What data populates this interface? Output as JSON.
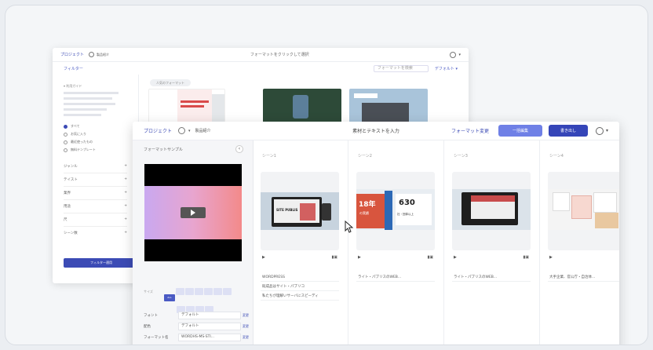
{
  "back_window": {
    "project": "プロジェクト",
    "project_sub": "製品紹介",
    "center_title": "フォーマットをクリックして選択",
    "filter": "フィルター",
    "search_placeholder": "フォーマットを検索",
    "sort": "デフォルト ▾",
    "section": "▾ 利用ガイド",
    "radios": [
      "すべて",
      "お気に入り",
      "最近使ったもの",
      "無料テンプレート"
    ],
    "categories": [
      "ジャンル",
      "テイスト",
      "業界",
      "用途",
      "尺",
      "シーン数"
    ],
    "apply_button": "フィルター適用",
    "tag": "人気のフォーマット"
  },
  "front_window": {
    "project": "プロジェクト",
    "project_sub": "製品紹介",
    "title": "素材とテキストを入力",
    "format_change": "フォーマット変更",
    "bulk_button": "一括編集",
    "export_button": "書き出し",
    "sample_label": "フォーマットサンプル",
    "ratio_label": "サイズ",
    "ratio_chips": [
      "ALL",
      "",
      "",
      "",
      "",
      "",
      "",
      "",
      "",
      "",
      ""
    ],
    "fields": [
      {
        "label": "フォント",
        "value": "デフォルト",
        "change": "変更"
      },
      {
        "label": "配色",
        "value": "デフォルト",
        "change": "変更"
      },
      {
        "label": "フォーマット名",
        "value": "WORDHS-MS-STI...",
        "change": "変更"
      }
    ],
    "scenes": [
      {
        "label": "シーン1",
        "lines": [
          "WORDPRESS",
          "既成品はサイト・パブリコ",
          "私たちが理解いサーバにスピーディ"
        ]
      },
      {
        "label": "シーン2",
        "lines": [
          "ライト・パブリスのWEB..."
        ],
        "big_num": "18年",
        "big_num2": "630",
        "caption": "の実績",
        "caption2": "社・団体以上"
      },
      {
        "label": "シーン3",
        "lines": [
          "ライト・パブリスのWEB..."
        ]
      },
      {
        "label": "シーン4",
        "lines": [
          "大手企業、官公庁・自治体..."
        ]
      }
    ],
    "mockup_text": "SITE PUBLIS"
  }
}
